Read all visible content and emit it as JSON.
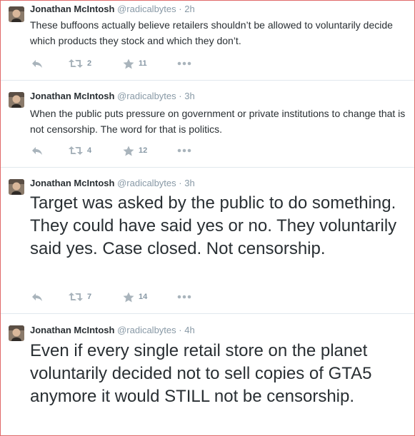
{
  "tweets": [
    {
      "name": "Jonathan McIntosh",
      "handle": "@radicalbytes",
      "separator": "·",
      "time": "2h",
      "text": "These buffoons actually believe retailers shouldn’t be allowed to voluntarily decide which products they stock and which they don’t.",
      "retweets": "2",
      "favorites": "11"
    },
    {
      "name": "Jonathan McIntosh",
      "handle": "@radicalbytes",
      "separator": "·",
      "time": "3h",
      "text": "When the public puts pressure on government or private institutions to change that is not censorship. The word for that is politics.",
      "retweets": "4",
      "favorites": "12"
    },
    {
      "name": "Jonathan McIntosh",
      "handle": "@radicalbytes",
      "separator": "·",
      "time": "3h",
      "text": "Target was asked by the public to do something. They could have said yes or no. They voluntarily said yes. Case closed. Not censorship.",
      "retweets": "7",
      "favorites": "14"
    },
    {
      "name": "Jonathan McIntosh",
      "handle": "@radicalbytes",
      "separator": "·",
      "time": "4h",
      "text": "Even if every single retail store on the planet voluntarily decided not to sell copies of GTA5 anymore it would STILL not be censorship.",
      "retweets": "",
      "favorites": ""
    }
  ],
  "icons": {
    "reply": "reply-icon",
    "retweet": "retweet-icon",
    "favorite": "star-icon",
    "more": "more-icon",
    "avatar": "avatar"
  },
  "colors": {
    "border": "#e06a6a",
    "divider": "#e1e8ed",
    "icon": "#a9b4bc",
    "muted": "#8899a6",
    "text": "#292f33"
  }
}
